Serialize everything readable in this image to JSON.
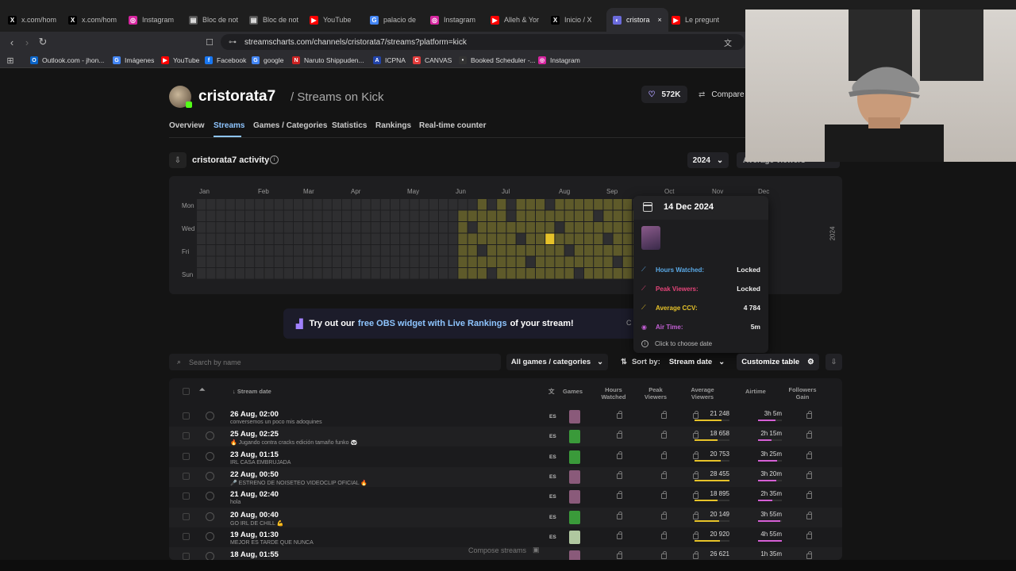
{
  "browser": {
    "tabs": [
      {
        "label": "x.com/hom",
        "icon": "x-icon",
        "color": "#000000",
        "glyph": "X"
      },
      {
        "label": "x.com/hom",
        "icon": "x-icon",
        "color": "#000000",
        "glyph": "X"
      },
      {
        "label": "Instagram",
        "icon": "instagram-icon",
        "color": "#d6249f",
        "glyph": "◎"
      },
      {
        "label": "Bloc de not",
        "icon": "notepad-icon",
        "color": "#555555",
        "glyph": "▤"
      },
      {
        "label": "Bloc de not",
        "icon": "notepad-icon",
        "color": "#555555",
        "glyph": "▤"
      },
      {
        "label": "YouTube",
        "icon": "youtube-icon",
        "color": "#ff0000",
        "glyph": "▶"
      },
      {
        "label": "palacio de",
        "icon": "google-icon",
        "color": "#4285f4",
        "glyph": "G"
      },
      {
        "label": "Instagram",
        "icon": "instagram-icon",
        "color": "#d6249f",
        "glyph": "◎"
      },
      {
        "label": "Alleh & Yor",
        "icon": "youtube-icon",
        "color": "#ff0000",
        "glyph": "▶"
      },
      {
        "label": "Inicio / X",
        "icon": "x-icon",
        "color": "#000000",
        "glyph": "X"
      },
      {
        "label": "cristora",
        "icon": "streamscharts-icon",
        "color": "#6b6bdc",
        "glyph": "◐",
        "active": true
      },
      {
        "label": "Le pregunt",
        "icon": "youtube-icon",
        "color": "#ff0000",
        "glyph": "▶"
      }
    ],
    "url": "streamscharts.com/channels/cristorata7/streams?platform=kick",
    "bookmarks": [
      {
        "label": "Outlook.com - jhon...",
        "color": "#0a64c8",
        "glyph": "O"
      },
      {
        "label": "Imágenes",
        "color": "#4285f4",
        "glyph": "G"
      },
      {
        "label": "YouTube",
        "color": "#ff0000",
        "glyph": "▶"
      },
      {
        "label": "Facebook",
        "color": "#1877f2",
        "glyph": "f"
      },
      {
        "label": "google",
        "color": "#4285f4",
        "glyph": "G"
      },
      {
        "label": "Naruto Shippuden...",
        "color": "#cc2222",
        "glyph": "N"
      },
      {
        "label": "ICPNA",
        "color": "#2244aa",
        "glyph": "A"
      },
      {
        "label": "CANVAS",
        "color": "#e23b3b",
        "glyph": "C"
      },
      {
        "label": "Booked Scheduler -...",
        "color": "#333333",
        "glyph": "•"
      },
      {
        "label": "Instagram",
        "color": "#d6249f",
        "glyph": "◎"
      }
    ]
  },
  "channel": {
    "name": "cristorata7",
    "subtitle": "/ Streams on Kick",
    "followers": "572K",
    "compare_label": "Compare"
  },
  "nav": {
    "items": [
      "Overview",
      "Streams",
      "Games / Categories",
      "Statistics",
      "Rankings",
      "Real-time counter"
    ],
    "active": "Streams"
  },
  "activity": {
    "title": "cristorata7 activity",
    "year": "2024",
    "metric": "Average viewers",
    "months": [
      "Jan",
      "Feb",
      "Mar",
      "Apr",
      "May",
      "Jun",
      "Jul",
      "Aug",
      "Sep",
      "Oct",
      "Nov",
      "Dec"
    ],
    "days": [
      "Mon",
      "Wed",
      "Fri",
      "Sun"
    ],
    "year_vertical": "2024",
    "colors": {
      "empty": "#2e2e30",
      "low": "#5e5a2a",
      "mid": "#8a7f2a",
      "high": "#e6c229"
    }
  },
  "tooltip": {
    "date": "14 Dec 2024",
    "rows": [
      {
        "label": "Hours Watched:",
        "value": "Locked",
        "color": "#5aa9e6",
        "icon": "chart-icon"
      },
      {
        "label": "Peak Viewers:",
        "value": "Locked",
        "color": "#e6457a",
        "icon": "peak-icon"
      },
      {
        "label": "Average CCV:",
        "value": "4 784",
        "color": "#e6c229",
        "icon": "avg-icon"
      },
      {
        "label": "Air Time:",
        "value": "5m",
        "color": "#c35fd4",
        "icon": "broadcast-icon"
      }
    ],
    "hint": "Click to choose date"
  },
  "banner": {
    "pre": "Try out our",
    "link": "free OBS widget with Live Rankings",
    "post": "of your stream!",
    "close": "C"
  },
  "filters": {
    "search_placeholder": "Search by name",
    "games": "All games / categories",
    "sort_label": "Sort by:",
    "sort_value": "Stream date",
    "customize": "Customize table"
  },
  "table": {
    "headers": {
      "stream_date": "Stream date",
      "games": "Games",
      "hours_watched": "Hours Watched",
      "peak_viewers": "Peak Viewers",
      "average_viewers": "Average Viewers",
      "airtime": "Airtime",
      "followers_gain": "Followers Gain"
    },
    "rows": [
      {
        "date": "26 Aug, 02:00",
        "title": "conversemos un poco mis adoquines",
        "lang": "ES",
        "game": "#8a5a7a",
        "avg": "21 248",
        "avg_pct": 0.78,
        "air": "3h 5m",
        "air_pct": 0.72
      },
      {
        "date": "25 Aug, 02:25",
        "title": "🔥 Jugando contra cracks edición tamaño funko 🐼",
        "lang": "ES",
        "game": "#3a9a3a",
        "avg": "18 658",
        "avg_pct": 0.66,
        "air": "2h 15m",
        "air_pct": 0.55
      },
      {
        "date": "23 Aug, 01:15",
        "title": "IRL CASA EMBRUJADA",
        "lang": "ES",
        "game": "#3a9a3a",
        "avg": "20 753",
        "avg_pct": 0.74,
        "air": "3h 25m",
        "air_pct": 0.8
      },
      {
        "date": "22 Aug, 00:50",
        "title": "🎤 ESTRENO DE NOISETEO VIDEOCLIP OFICIAL 🔥",
        "lang": "ES",
        "game": "#8a5a7a",
        "avg": "28 455",
        "avg_pct": 1.0,
        "air": "3h 20m",
        "air_pct": 0.78
      },
      {
        "date": "21 Aug, 02:40",
        "title": "hola",
        "lang": "ES",
        "game": "#8a5a7a",
        "avg": "18 895",
        "avg_pct": 0.67,
        "air": "2h 35m",
        "air_pct": 0.6
      },
      {
        "date": "20 Aug, 00:40",
        "title": "GO IRL DE CHILL 💪",
        "lang": "ES",
        "game": "#3a9a3a",
        "avg": "20 149",
        "avg_pct": 0.71,
        "air": "3h 55m",
        "air_pct": 0.92
      },
      {
        "date": "19 Aug, 01:30",
        "title": "MEJOR ES TARDE QUE NUNCA",
        "lang": "ES",
        "game": "#b0c8a0",
        "avg": "20 920",
        "avg_pct": 0.73,
        "air": "4h 55m",
        "air_pct": 1.0
      },
      {
        "date": "18 Aug, 01:55",
        "title": "",
        "lang": "",
        "game": "#8a5a7a",
        "avg": "26 621",
        "avg_pct": 0.93,
        "air": "1h 35m",
        "air_pct": 0.4
      }
    ],
    "compose": "Compose streams"
  }
}
